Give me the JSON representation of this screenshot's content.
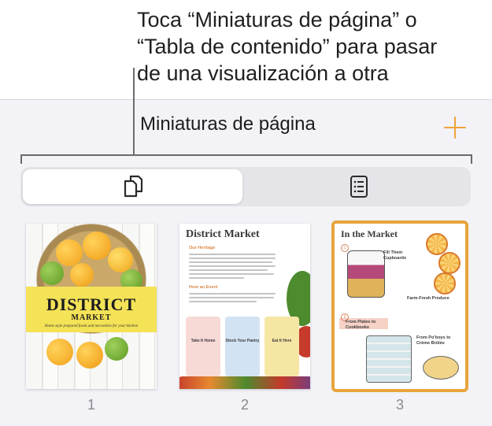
{
  "callout": {
    "line1": "Toca “Miniaturas de página” o",
    "line2": "“Tabla de contenido” para pasar",
    "line3": "de una visualización a otra"
  },
  "panel": {
    "title": "Miniaturas de página",
    "add_icon": "plus-icon",
    "accent_color": "#f0a33a"
  },
  "segmented": {
    "items": [
      {
        "icon": "page-thumbnails-icon",
        "selected": true
      },
      {
        "icon": "table-of-contents-icon",
        "selected": false
      }
    ]
  },
  "pages": [
    {
      "number": "1",
      "cover_title": "DISTRICT",
      "cover_subtitle": "MARKET",
      "cover_tagline": "Home style prepared foods and necessities for your kitchen"
    },
    {
      "number": "2",
      "title": "District Market",
      "section1": "Our Heritage",
      "section2": "Host an Event",
      "cards": [
        "Take It Home",
        "Stock Your Pantry",
        "Eat It Here"
      ]
    },
    {
      "number": "3",
      "title": "In the Market",
      "items": [
        "Fill Them Cupboards",
        "Farm-Fresh Produce",
        "From Plates to Cookbooks",
        "From Po’boys to Crème Brûlée"
      ],
      "selected": true
    }
  ]
}
